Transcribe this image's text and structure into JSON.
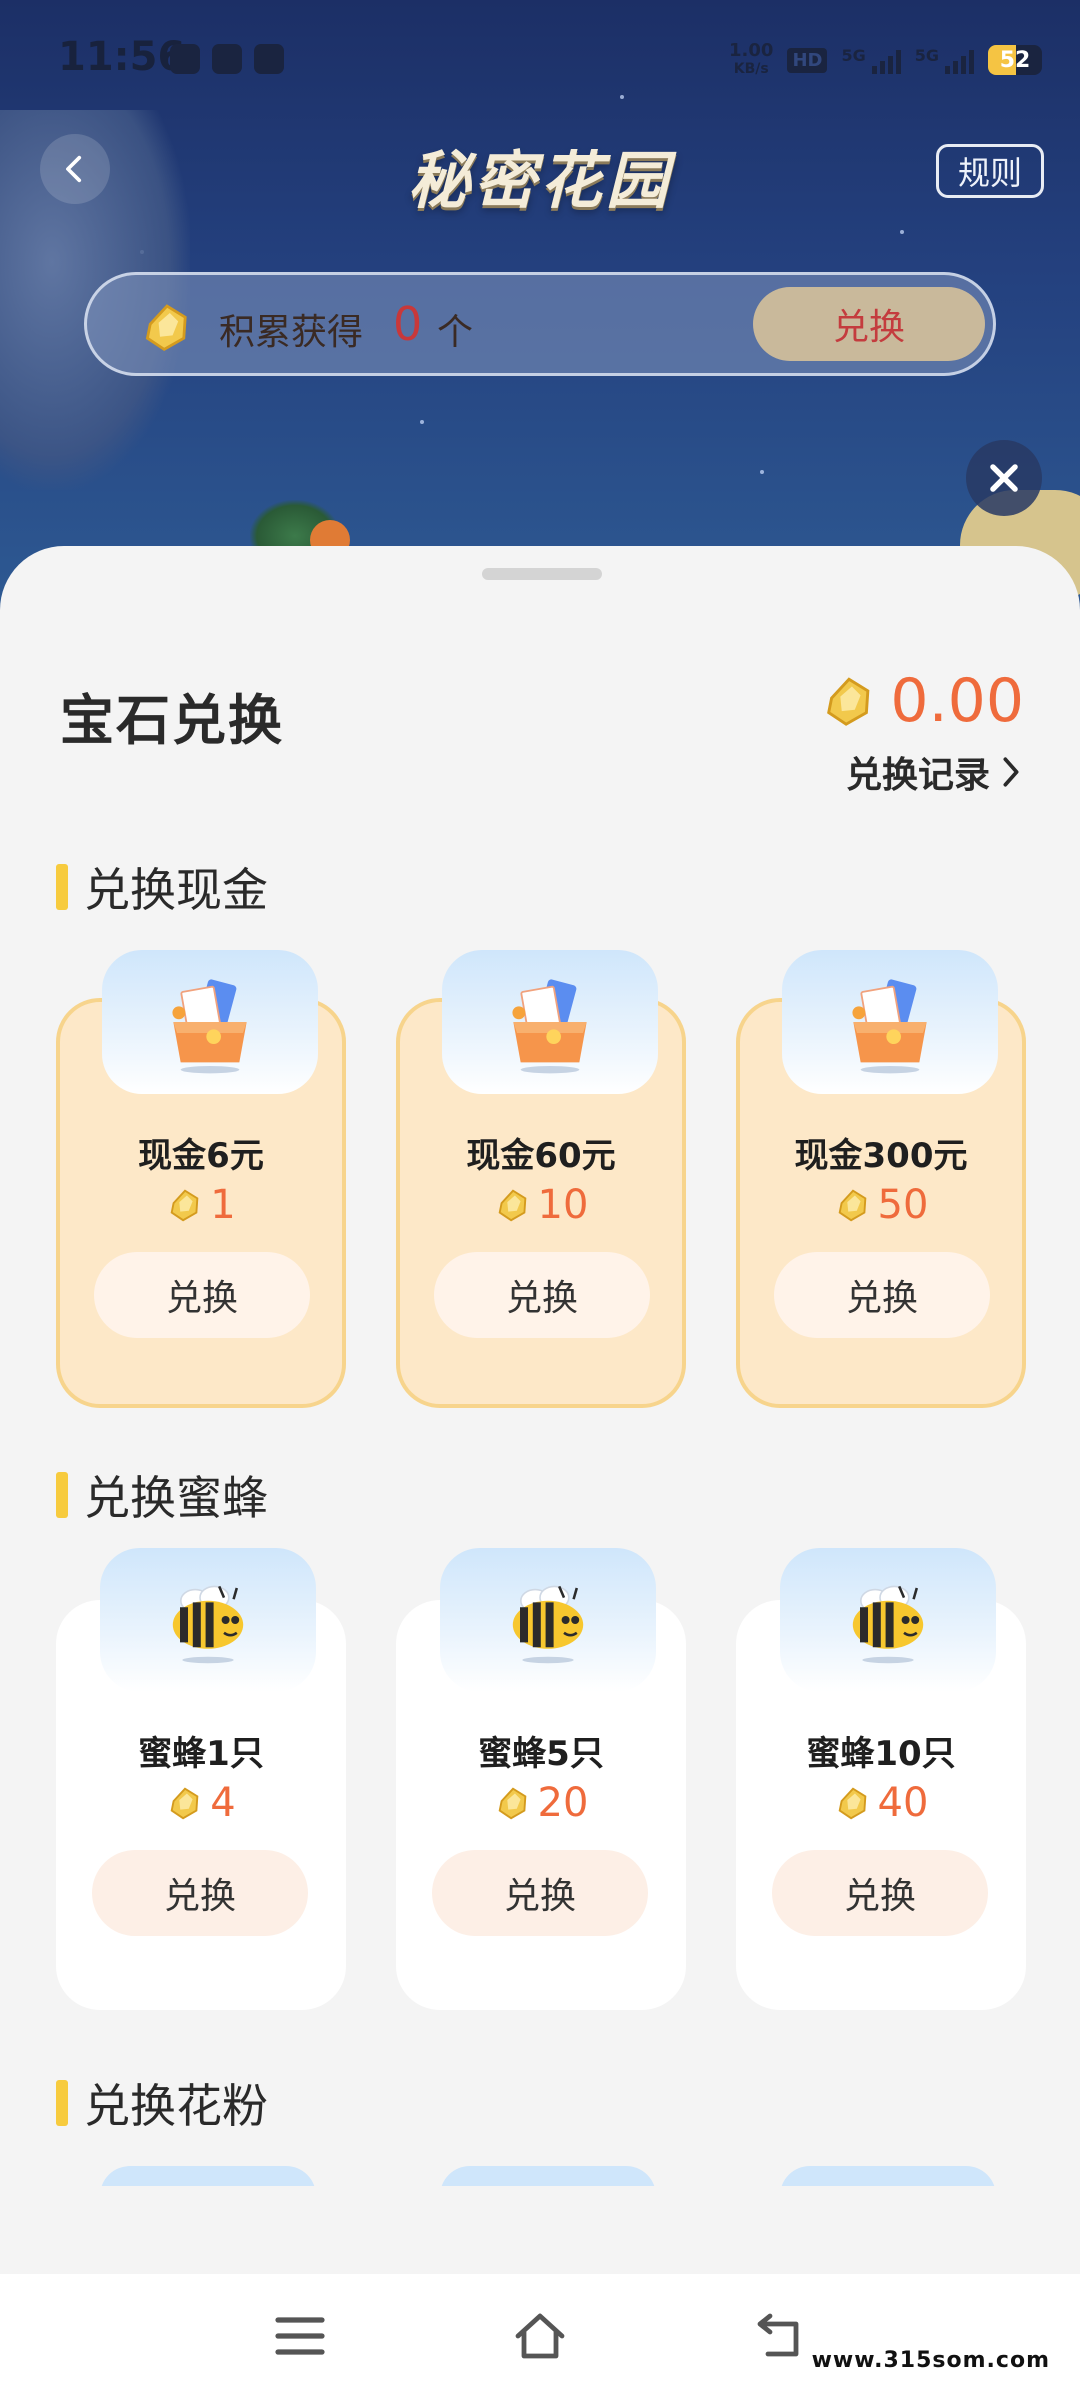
{
  "status_bar": {
    "time": "11:56",
    "net_speed": "1.00",
    "net_unit": "KB/s",
    "hd_label": "HD",
    "sim1_label": "5G",
    "sim2_label": "5G",
    "battery_level": "52"
  },
  "header": {
    "title": "秘密花园",
    "rules_label": "规则"
  },
  "accumulate": {
    "label": "积累获得",
    "count": "0",
    "unit": "个",
    "button_label": "兑换"
  },
  "sheet": {
    "title": "宝石兑换",
    "balance": "0.00",
    "record_link": "兑换记录"
  },
  "sections": {
    "cash": {
      "title": "兑换现金",
      "items": [
        {
          "name": "现金6元",
          "cost": "1",
          "button": "兑换"
        },
        {
          "name": "现金60元",
          "cost": "10",
          "button": "兑换"
        },
        {
          "name": "现金300元",
          "cost": "50",
          "button": "兑换"
        }
      ]
    },
    "bee": {
      "title": "兑换蜜蜂",
      "items": [
        {
          "name": "蜜蜂1只",
          "cost": "4",
          "button": "兑换"
        },
        {
          "name": "蜜蜂5只",
          "cost": "20",
          "button": "兑换"
        },
        {
          "name": "蜜蜂10只",
          "cost": "40",
          "button": "兑换"
        }
      ]
    },
    "pollen": {
      "title": "兑换花粉"
    }
  },
  "watermark": "www.315som.com",
  "colors": {
    "accent_orange": "#ef6b3c",
    "section_bar": "#f7cb3e",
    "cash_card_bg": "#fde8c8",
    "counter_red": "#c8383a"
  },
  "icons": [
    "back-arrow-icon",
    "gem-icon",
    "close-icon",
    "chevron-right-icon",
    "cash-gift-box-icon",
    "bee-icon",
    "menu-icon",
    "home-icon",
    "back-icon"
  ]
}
